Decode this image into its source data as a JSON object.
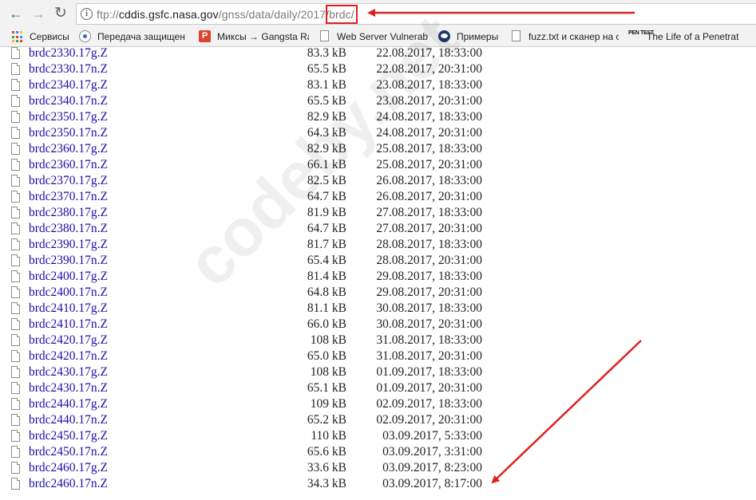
{
  "toolbar": {
    "back_icon": "back-arrow-icon",
    "forward_icon": "forward-arrow-icon",
    "reload_icon": "reload-icon",
    "info_icon": "info-icon",
    "url_scheme": "ftp://",
    "url_host": "cddis.gsfc.nasa.gov",
    "url_path": "/gnss/data/daily/2017",
    "url_sep": "/",
    "url_last_segment": "brdc/"
  },
  "bookmarks": [
    {
      "label": "Сервисы",
      "icon": "apps-grid-icon"
    },
    {
      "label": "Передача защищен",
      "icon": "eye-icon"
    },
    {
      "label": "Миксы → Gangsta Ra",
      "icon": "p-logo-icon"
    },
    {
      "label": "Web Server Vulnerab",
      "icon": "page-icon"
    },
    {
      "label": "Примеры",
      "icon": "eye-logo-icon"
    },
    {
      "label": "fuzz.txt и сканер на с",
      "icon": "page-icon"
    },
    {
      "label": "The Life of a Penetrat",
      "icon": "pentest-icon",
      "icon_text": "PEN TEST"
    }
  ],
  "files": [
    {
      "name": "brdc2330.17g.Z",
      "size": "83.3 kB",
      "date": "22.08.2017, 18:33:00"
    },
    {
      "name": "brdc2330.17n.Z",
      "size": "65.5 kB",
      "date": "22.08.2017, 20:31:00"
    },
    {
      "name": "brdc2340.17g.Z",
      "size": "83.1 kB",
      "date": "23.08.2017, 18:33:00"
    },
    {
      "name": "brdc2340.17n.Z",
      "size": "65.5 kB",
      "date": "23.08.2017, 20:31:00"
    },
    {
      "name": "brdc2350.17g.Z",
      "size": "82.9 kB",
      "date": "24.08.2017, 18:33:00"
    },
    {
      "name": "brdc2350.17n.Z",
      "size": "64.3 kB",
      "date": "24.08.2017, 20:31:00"
    },
    {
      "name": "brdc2360.17g.Z",
      "size": "82.9 kB",
      "date": "25.08.2017, 18:33:00"
    },
    {
      "name": "brdc2360.17n.Z",
      "size": "66.1 kB",
      "date": "25.08.2017, 20:31:00"
    },
    {
      "name": "brdc2370.17g.Z",
      "size": "82.5 kB",
      "date": "26.08.2017, 18:33:00"
    },
    {
      "name": "brdc2370.17n.Z",
      "size": "64.7 kB",
      "date": "26.08.2017, 20:31:00"
    },
    {
      "name": "brdc2380.17g.Z",
      "size": "81.9 kB",
      "date": "27.08.2017, 18:33:00"
    },
    {
      "name": "brdc2380.17n.Z",
      "size": "64.7 kB",
      "date": "27.08.2017, 20:31:00"
    },
    {
      "name": "brdc2390.17g.Z",
      "size": "81.7 kB",
      "date": "28.08.2017, 18:33:00"
    },
    {
      "name": "brdc2390.17n.Z",
      "size": "65.4 kB",
      "date": "28.08.2017, 20:31:00"
    },
    {
      "name": "brdc2400.17g.Z",
      "size": "81.4 kB",
      "date": "29.08.2017, 18:33:00"
    },
    {
      "name": "brdc2400.17n.Z",
      "size": "64.8 kB",
      "date": "29.08.2017, 20:31:00"
    },
    {
      "name": "brdc2410.17g.Z",
      "size": "81.1 kB",
      "date": "30.08.2017, 18:33:00"
    },
    {
      "name": "brdc2410.17n.Z",
      "size": "66.0 kB",
      "date": "30.08.2017, 20:31:00"
    },
    {
      "name": "brdc2420.17g.Z",
      "size": "108 kB",
      "date": "31.08.2017, 18:33:00"
    },
    {
      "name": "brdc2420.17n.Z",
      "size": "65.0 kB",
      "date": "31.08.2017, 20:31:00"
    },
    {
      "name": "brdc2430.17g.Z",
      "size": "108 kB",
      "date": "01.09.2017, 18:33:00"
    },
    {
      "name": "brdc2430.17n.Z",
      "size": "65.1 kB",
      "date": "01.09.2017, 20:31:00"
    },
    {
      "name": "brdc2440.17g.Z",
      "size": "109 kB",
      "date": "02.09.2017, 18:33:00"
    },
    {
      "name": "brdc2440.17n.Z",
      "size": "65.2 kB",
      "date": "02.09.2017, 20:31:00"
    },
    {
      "name": "brdc2450.17g.Z",
      "size": "110 kB",
      "date": "03.09.2017, 5:33:00"
    },
    {
      "name": "brdc2450.17n.Z",
      "size": "65.6 kB",
      "date": "03.09.2017, 3:31:00"
    },
    {
      "name": "brdc2460.17g.Z",
      "size": "33.6 kB",
      "date": "03.09.2017, 8:23:00"
    },
    {
      "name": "brdc2460.17n.Z",
      "size": "34.3 kB",
      "date": "03.09.2017, 8:17:00"
    }
  ],
  "watermark": "codeby.net",
  "colors": {
    "link": "#1a0dab",
    "annotation_red": "#e02020",
    "chrome_bg": "#f2f2f2"
  }
}
